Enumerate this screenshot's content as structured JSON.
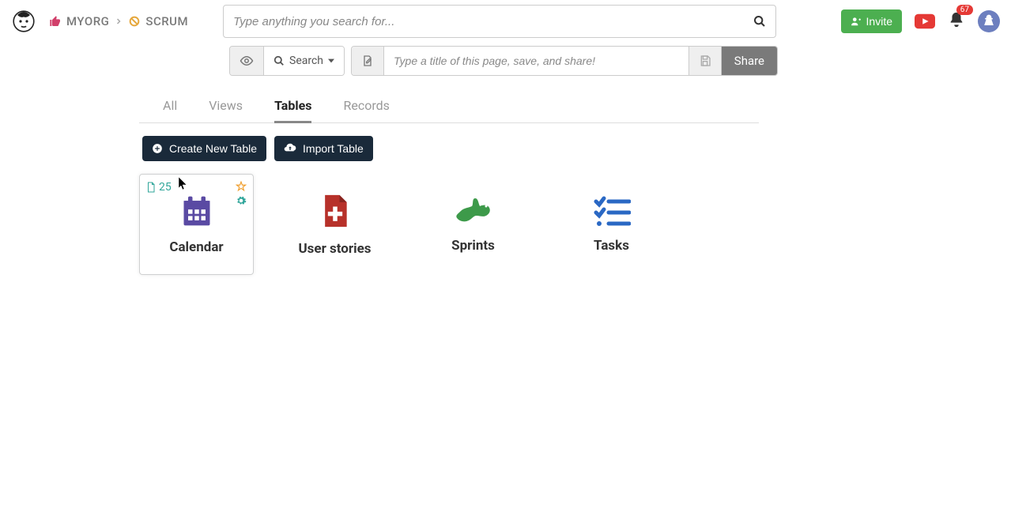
{
  "breadcrumbs": {
    "org": "MYORG",
    "project": "SCRUM"
  },
  "search": {
    "placeholder": "Type anything you search for..."
  },
  "subbar": {
    "search_label": "Search",
    "title_placeholder": "Type a title of this page, save, and share!",
    "share_label": "Share"
  },
  "header": {
    "invite_label": "Invite",
    "notification_count": "67"
  },
  "tabs": [
    {
      "label": "All",
      "active": false
    },
    {
      "label": "Views",
      "active": false
    },
    {
      "label": "Tables",
      "active": true
    },
    {
      "label": "Records",
      "active": false
    }
  ],
  "actions": {
    "create_label": "Create New Table",
    "import_label": "Import Table"
  },
  "cards": [
    {
      "title": "Calendar",
      "icon": "calendar",
      "color": "#5a4aa3",
      "count": "25",
      "hover": true
    },
    {
      "title": "User stories",
      "icon": "medkit",
      "color": "#b7312a"
    },
    {
      "title": "Sprints",
      "icon": "rabbit",
      "color": "#3d9a4a"
    },
    {
      "title": "Tasks",
      "icon": "checklist",
      "color": "#2a68c4"
    }
  ]
}
